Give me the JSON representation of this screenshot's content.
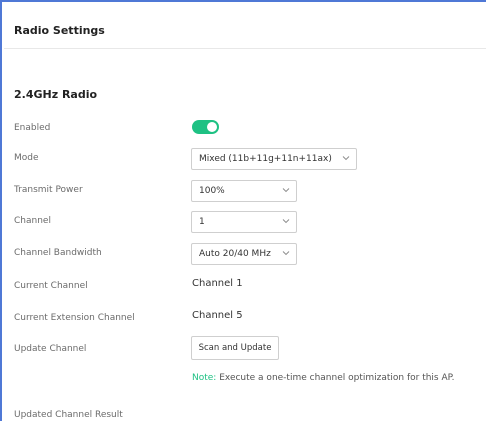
{
  "panel": {
    "title": "Radio Settings"
  },
  "section": {
    "title": "2.4GHz Radio"
  },
  "enabled": {
    "label": "Enabled",
    "on": true,
    "on_color": "#1ec183"
  },
  "mode": {
    "label": "Mode",
    "value": "Mixed (11b+11g+11n+11ax)"
  },
  "transmit_power": {
    "label": "Transmit Power",
    "value": "100%"
  },
  "channel": {
    "label": "Channel",
    "value": "1"
  },
  "channel_bandwidth": {
    "label": "Channel Bandwidth",
    "value": "Auto 20/40 MHz"
  },
  "current_channel": {
    "label": "Current Channel",
    "value": "Channel 1"
  },
  "current_extension_channel": {
    "label": "Current Extension Channel",
    "value": "Channel 5"
  },
  "update_channel": {
    "label": "Update Channel",
    "button_label": "Scan and Update"
  },
  "note": {
    "prefix": "Note:",
    "text": " Execute a one-time channel optimization for this AP."
  },
  "updated_channel_result": {
    "label": "Updated Channel Result"
  },
  "colors": {
    "accent": "#1ec183",
    "frame_border": "#4f78d6"
  }
}
